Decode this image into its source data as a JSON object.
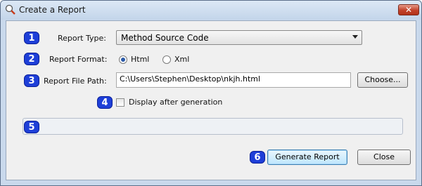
{
  "window": {
    "title": "Create a Report",
    "close_label": "✕"
  },
  "badges": [
    "1",
    "2",
    "3",
    "4",
    "5",
    "6"
  ],
  "report_type": {
    "label": "Report Type:",
    "selected": "Method Source Code"
  },
  "report_format": {
    "label": "Report Format:",
    "options": [
      "Html",
      "Xml"
    ],
    "selected": "Html"
  },
  "report_file_path": {
    "label": "Report File Path:",
    "value": "C:\\Users\\Stephen\\Desktop\\nkjh.html",
    "choose_label": "Choose..."
  },
  "display_after": {
    "label": "Display after generation",
    "checked": false
  },
  "progress": {
    "value": 0
  },
  "actions": {
    "generate_label": "Generate Report",
    "close_label": "Close"
  }
}
